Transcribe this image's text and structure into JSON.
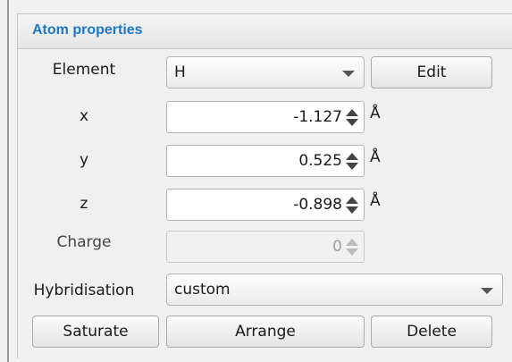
{
  "panel": {
    "title": "Atom properties"
  },
  "element": {
    "label": "Element",
    "value": "H",
    "edit_label": "Edit"
  },
  "coords": {
    "x": {
      "label": "x",
      "value": "-1.127",
      "unit": "Å"
    },
    "y": {
      "label": "y",
      "value": "0.525",
      "unit": "Å"
    },
    "z": {
      "label": "z",
      "value": "-0.898",
      "unit": "Å"
    }
  },
  "charge": {
    "label": "Charge",
    "value": "0",
    "enabled": false
  },
  "hybridisation": {
    "label": "Hybridisation",
    "value": "custom"
  },
  "actions": {
    "saturate": "Saturate",
    "arrange": "Arrange",
    "delete": "Delete"
  },
  "colors": {
    "title": "#1f77c4",
    "background": "#f0f0f0"
  }
}
